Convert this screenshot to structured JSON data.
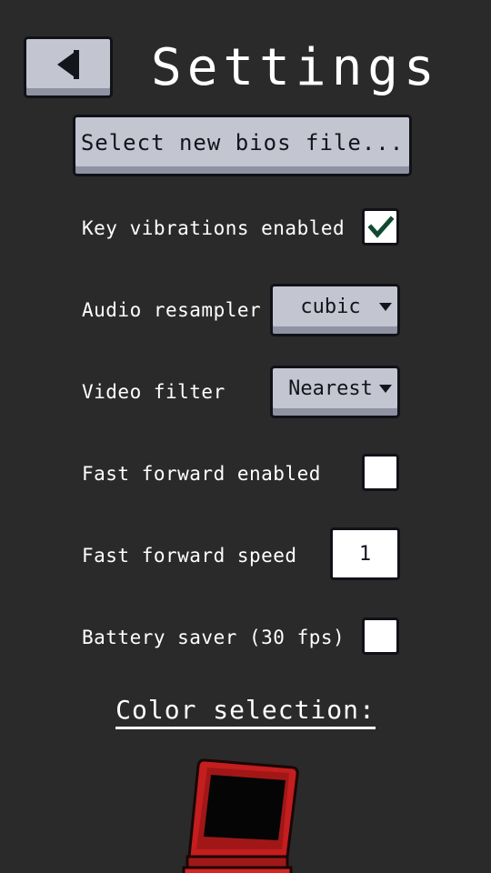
{
  "header": {
    "title": "Settings",
    "back_icon": "back-arrow-icon"
  },
  "bios_button": {
    "label": "Select new bios file..."
  },
  "settings": {
    "key_vibrations": {
      "label": "Key vibrations enabled",
      "checked": true
    },
    "audio_resampler": {
      "label": "Audio resampler",
      "value": "cubic"
    },
    "video_filter": {
      "label": "Video filter",
      "value": "Nearest"
    },
    "fast_forward_enabled": {
      "label": "Fast forward enabled",
      "checked": false
    },
    "fast_forward_speed": {
      "label": "Fast forward speed",
      "value": "1"
    },
    "battery_saver": {
      "label": "Battery saver (30 fps)",
      "checked": false
    }
  },
  "color_selection": {
    "title": "Color selection:",
    "selected_color": "#c41e1e",
    "icon": "handheld-console-icon"
  },
  "colors": {
    "background": "#2a2a2a",
    "button_face": "#c3c6d0",
    "button_shadow": "#8e92a2",
    "checkmark": "#0f4a30"
  }
}
